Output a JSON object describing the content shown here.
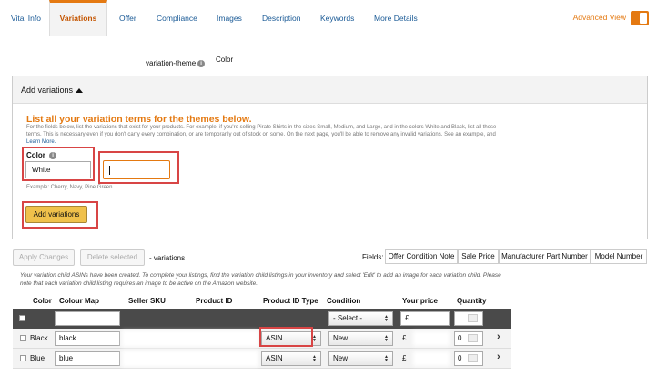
{
  "tabs": [
    "Vital Info",
    "Variations",
    "Offer",
    "Compliance",
    "Images",
    "Description",
    "Keywords",
    "More Details"
  ],
  "advanced_view": "Advanced View",
  "variation_theme": {
    "label": "variation-theme",
    "value": "Color"
  },
  "add_variations": {
    "header": "Add variations",
    "title": "List all your variation terms for the themes below.",
    "description": "For the fields below, list the variations that exist for your products. For example, if you're selling Pirate Shirts in the sizes Small, Medium, and Large, and in the colors White and Black, list all those terms. This is necessary even if you don't carry every combination, or are temporarily out of stock on some. On the next page, you'll be able to remove any invalid variations. See an example, and",
    "learn_more": "Learn More.",
    "color_label": "Color",
    "color_value": "White",
    "example": "Example:  Cherry, Navy, Pine Green",
    "button": "Add variations"
  },
  "toolbar": {
    "apply": "Apply Changes",
    "delete": "Delete selected",
    "variations": "- variations",
    "fields_label": "Fields:",
    "fields": [
      "Offer Condition Note",
      "Sale Price",
      "Manufacturer Part Number",
      "Model Number"
    ]
  },
  "note": "Your variation child ASINs have been created. To complete your listings, find the variation child listings in your inventory and select 'Edit' to add an image for each variation child. Please note that each variation child listing requires an image to be active on the Amazon website.",
  "table": {
    "headers": [
      "Color",
      "Colour Map",
      "Seller SKU",
      "Product ID",
      "Product ID Type",
      "Condition",
      "Your price",
      "Quantity"
    ],
    "bulk": {
      "condition": "- Select -",
      "currency": "£"
    },
    "rows": [
      {
        "color": "Black",
        "colour_map": "black",
        "product_id_type": "ASIN",
        "condition": "New",
        "currency": "£",
        "quantity": "0"
      },
      {
        "color": "Blue",
        "colour_map": "blue",
        "product_id_type": "ASIN",
        "condition": "New",
        "currency": "£",
        "quantity": "0"
      }
    ]
  },
  "colors": {
    "accent": "#e47911",
    "link": "#1a5a96",
    "highlight_box": "#d84545",
    "button": "#f0c14b"
  }
}
